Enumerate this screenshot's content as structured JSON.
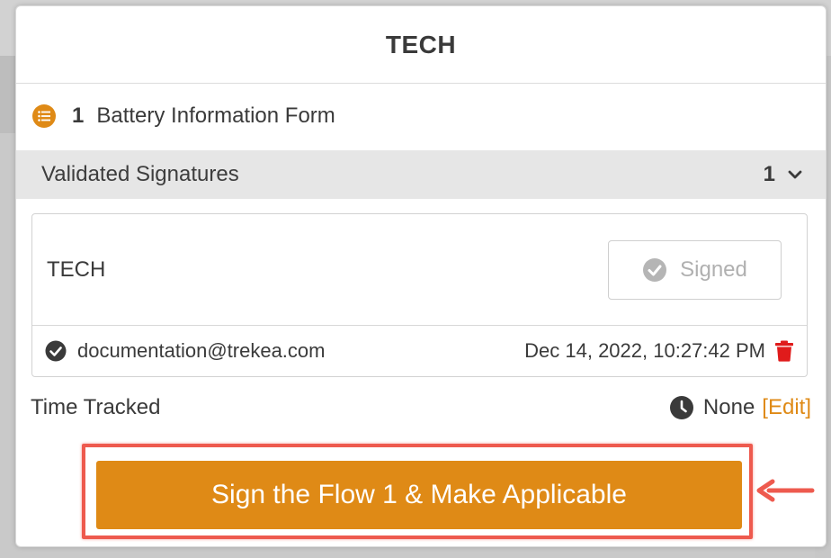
{
  "modal": {
    "title": "TECH"
  },
  "form": {
    "count": "1",
    "name": "Battery Information Form",
    "icon": "list-icon"
  },
  "signatures": {
    "title": "Validated Signatures",
    "count": "1",
    "expand_icon": "chevron-down-icon",
    "items": [
      {
        "role": "TECH",
        "status_label": "Signed",
        "user_email": "documentation@trekea.com",
        "signed_at": "Dec 14, 2022, 10:27:42 PM"
      }
    ]
  },
  "time_tracked": {
    "label": "Time Tracked",
    "value": "None",
    "edit_label": "[Edit]",
    "icon": "clock-icon"
  },
  "primary_action": {
    "label": "Sign the Flow 1 & Make Applicable"
  },
  "colors": {
    "accent": "#df8a16",
    "highlight": "#ee5a4e",
    "delete": "#e01b1b"
  }
}
